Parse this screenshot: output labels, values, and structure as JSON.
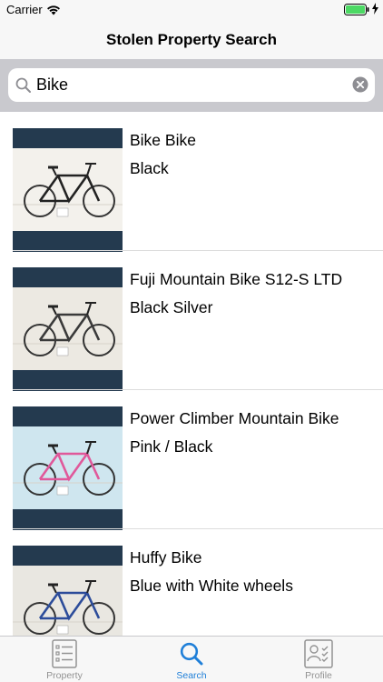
{
  "status_bar": {
    "carrier": "Carrier"
  },
  "nav": {
    "title": "Stolen Property Search"
  },
  "search": {
    "value": "Bike"
  },
  "results": [
    {
      "title": "Bike Bike",
      "subtitle": "Black",
      "photo_bg": "#f3f1ec",
      "frame_color": "#222222"
    },
    {
      "title": "Fuji Mountain Bike S12-S LTD",
      "subtitle": "Black Silver",
      "photo_bg": "#ece9e2",
      "frame_color": "#3a3a3a"
    },
    {
      "title": "Power Climber Mountain Bike",
      "subtitle": "Pink / Black",
      "photo_bg": "#cfe6ef",
      "frame_color": "#e0589a"
    },
    {
      "title": "Huffy Bike",
      "subtitle": "Blue with White wheels",
      "photo_bg": "#e9e7e1",
      "frame_color": "#2c4c9a"
    }
  ],
  "tabs": [
    {
      "label": "Property",
      "icon": "property-icon",
      "active": false
    },
    {
      "label": "Search",
      "icon": "search-icon",
      "active": true
    },
    {
      "label": "Profile",
      "icon": "profile-icon",
      "active": false
    }
  ],
  "colors": {
    "accent": "#1f7fd8",
    "thumb_frame": "#243a4f",
    "battery": "#4cd964"
  }
}
